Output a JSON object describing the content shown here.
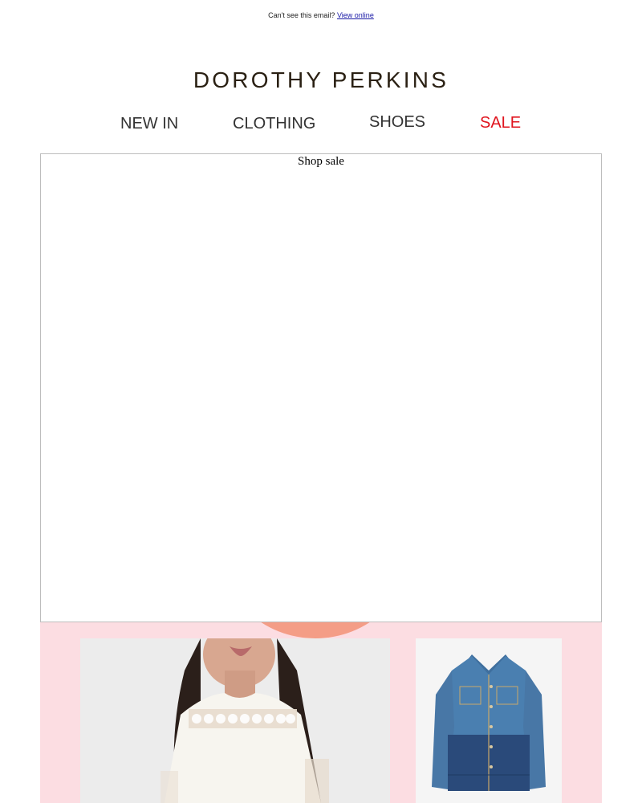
{
  "preheader": {
    "text": "Can't see this email?",
    "link": "View online"
  },
  "brand": {
    "logo_text": "DOROTHY PERKINS"
  },
  "nav": {
    "items": [
      {
        "label": "NEW IN"
      },
      {
        "label": "CLOTHING"
      },
      {
        "label": "SHOES"
      },
      {
        "label": "SALE"
      }
    ]
  },
  "hero": {
    "alt_text": "Shop sale"
  },
  "colors": {
    "sale": "#e0141e",
    "promo_bg": "#fcdde2",
    "accent_arc": "#f49d86",
    "logo": "#2a2013",
    "link": "#1a1aa6"
  }
}
